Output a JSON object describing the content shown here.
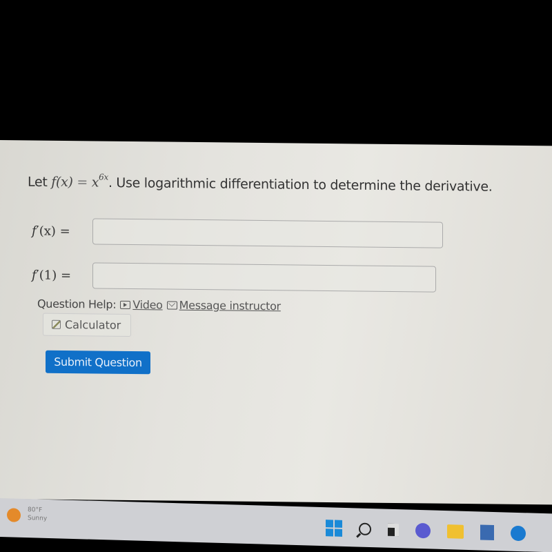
{
  "question": {
    "prefix": "Let ",
    "func": "f(x)",
    "equals": " = ",
    "base": "x",
    "exponent": "6x",
    "suffix": ". Use logarithmic differentiation to determine the derivative."
  },
  "answers": [
    {
      "label_func": "f",
      "label_rest": "′(x) =",
      "value": ""
    },
    {
      "label_func": "f",
      "label_rest": "′(1) =",
      "value": ""
    }
  ],
  "help": {
    "label": "Question Help:",
    "video": "Video",
    "message": "Message instructor",
    "calculator": "Calculator"
  },
  "submit_label": "Submit Question",
  "taskbar": {
    "temperature": "80°F",
    "condition": "Sunny",
    "icons": [
      "windows-start",
      "search",
      "task-view",
      "teams-chat",
      "file-explorer",
      "microsoft-store",
      "edge"
    ]
  }
}
